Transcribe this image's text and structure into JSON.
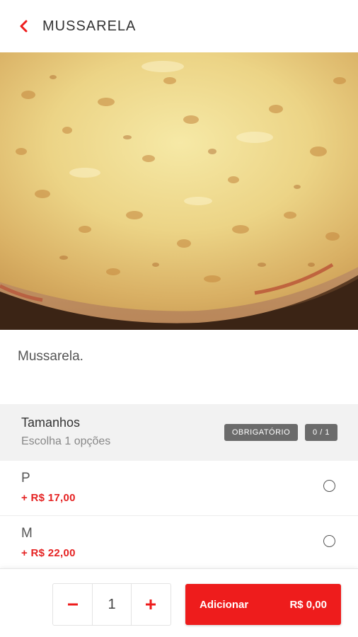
{
  "header": {
    "title": "MUSSARELA",
    "back_icon": "chevron-left-icon"
  },
  "product": {
    "description": "Mussarela."
  },
  "section": {
    "title": "Tamanhos",
    "subtitle": "Escolha 1 opções",
    "required_badge": "OBRIGATÓRIO",
    "count_badge": "0 / 1"
  },
  "options": [
    {
      "name": "P",
      "price": "+ R$ 17,00",
      "selected": false
    },
    {
      "name": "M",
      "price": "+ R$ 22,00",
      "selected": false
    }
  ],
  "footer": {
    "quantity": "1",
    "add_label": "Adicionar",
    "total": "R$ 0,00"
  },
  "colors": {
    "accent": "#ee1c1c",
    "price": "#e52222",
    "badge": "#6b6b6b"
  }
}
